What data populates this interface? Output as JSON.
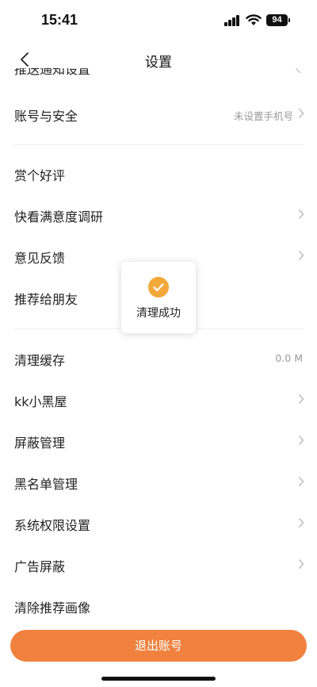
{
  "status_bar": {
    "time": "15:41",
    "battery": "94"
  },
  "nav": {
    "title": "设置"
  },
  "rows": {
    "cut_top": {
      "label": "推送通知设置"
    },
    "account": {
      "label": "账号与安全",
      "value": "未设置手机号"
    },
    "rate": {
      "label": "赏个好评"
    },
    "survey": {
      "label": "快看满意度调研"
    },
    "feedback": {
      "label": "意见反馈"
    },
    "recommend": {
      "label": "推荐给朋友"
    },
    "cache": {
      "label": "清理缓存",
      "value": "0.0 M"
    },
    "kk_room": {
      "label": "kk小黑屋"
    },
    "block_manage": {
      "label": "屏蔽管理"
    },
    "blacklist": {
      "label": "黑名单管理"
    },
    "permissions": {
      "label": "系统权限设置"
    },
    "ad_block": {
      "label": "广告屏蔽"
    },
    "clear_profile": {
      "label": "清除推荐画像"
    }
  },
  "toast": {
    "text": "清理成功"
  },
  "logout": {
    "label": "退出账号"
  },
  "colors": {
    "accent": "#f0813e",
    "toast_icon": "#f3a83b"
  }
}
